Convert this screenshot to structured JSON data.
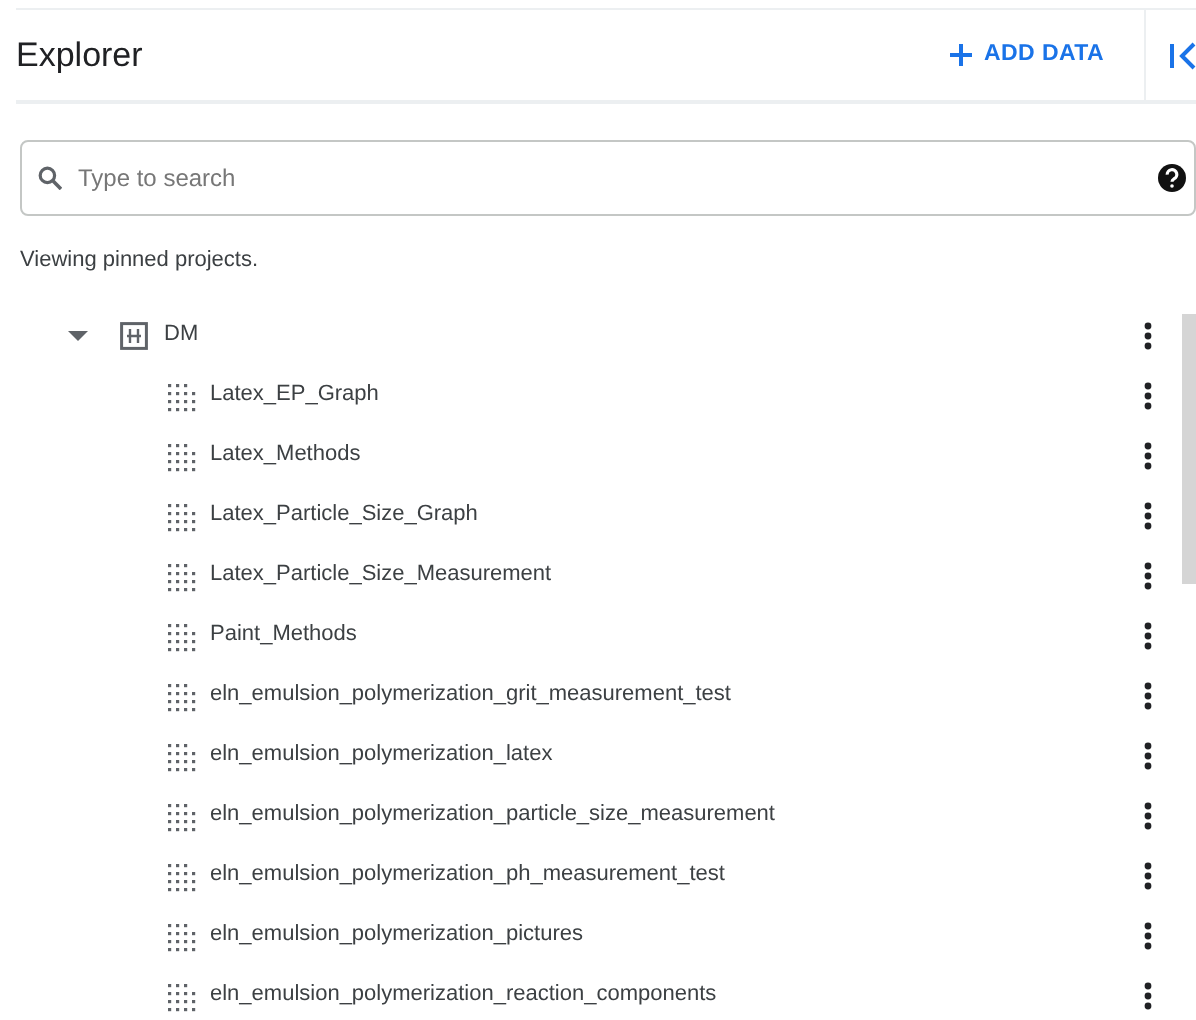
{
  "header": {
    "title": "Explorer",
    "add_data_label": "ADD DATA"
  },
  "search": {
    "placeholder": "Type to search"
  },
  "info_text": "Viewing pinned projects.",
  "tree": [
    {
      "name": "DM",
      "expanded": true,
      "children": [
        {
          "name": "Latex_EP_Graph"
        },
        {
          "name": "Latex_Methods"
        },
        {
          "name": "Latex_Particle_Size_Graph"
        },
        {
          "name": "Latex_Particle_Size_Measurement"
        },
        {
          "name": "Paint_Methods"
        },
        {
          "name": "eln_emulsion_polymerization_grit_measurement_test"
        },
        {
          "name": "eln_emulsion_polymerization_latex"
        },
        {
          "name": "eln_emulsion_polymerization_particle_size_measurement"
        },
        {
          "name": "eln_emulsion_polymerization_ph_measurement_test"
        },
        {
          "name": "eln_emulsion_polymerization_pictures"
        },
        {
          "name": "eln_emulsion_polymerization_reaction_components"
        }
      ]
    }
  ]
}
